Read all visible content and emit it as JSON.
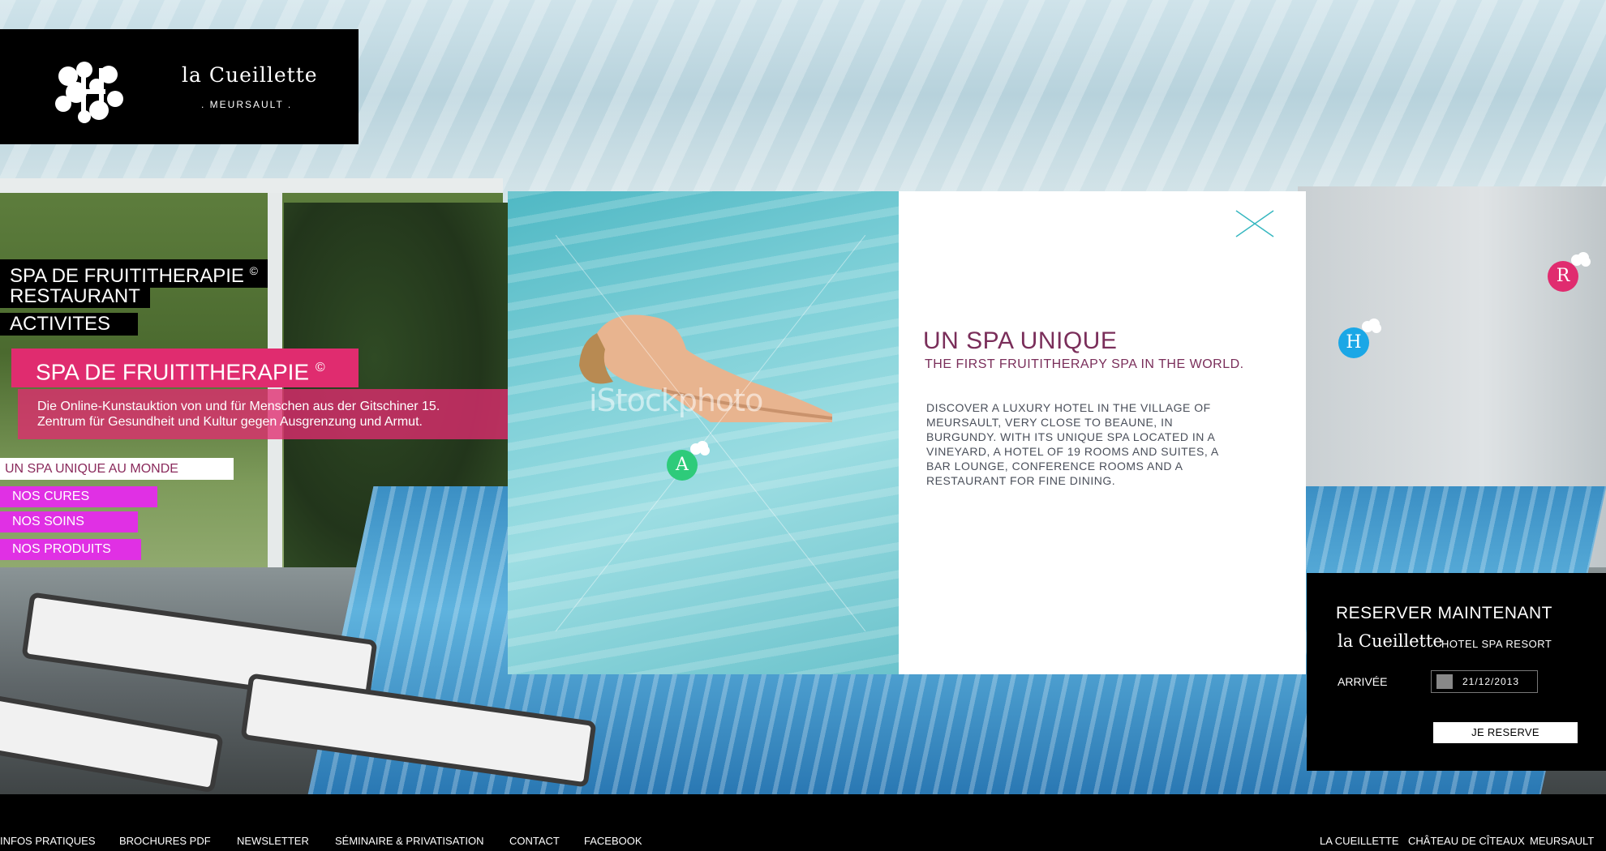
{
  "brand": {
    "name": "la Cueillette",
    "city": ". MEURSAULT ."
  },
  "main_menu": [
    {
      "label": "SPA DE FRUITITHERAPIE",
      "mark": "©"
    },
    {
      "label": "RESTAURANT"
    },
    {
      "label": "ACTIVITES"
    }
  ],
  "feature": {
    "title": "SPA DE FRUITITHERAPIE",
    "mark": "©",
    "description_line1": "Die Online-Kunstauktion von und für Menschen aus der Gitschiner 15.",
    "description_line2": "Zentrum für Gesundheit und Kultur gegen Ausgrenzung und Armut."
  },
  "sub_menu": {
    "active": "UN SPA UNIQUE AU MONDE",
    "items": [
      "NOS CURES",
      "NOS SOINS",
      "NOS PRODUITS"
    ]
  },
  "modal": {
    "title": "UN SPA UNIQUE",
    "subtitle": "THE FIRST FRUITITHERAPY SPA IN THE WORLD.",
    "body_lines": [
      "DISCOVER A LUXURY HOTEL IN THE VILLAGE OF",
      "MEURSAULT, VERY CLOSE TO BEAUNE, IN",
      "BURGUNDY. WITH ITS UNIQUE SPA LOCATED IN A",
      "VINEYARD, A HOTEL OF 19 ROOMS AND SUITES, A",
      "BAR LOUNGE, CONFERENCE ROOMS AND A",
      "RESTAURANT FOR FINE DINING."
    ],
    "photo_watermark": "iStockphoto",
    "close_icon": "close-x-icon"
  },
  "bubbles": [
    {
      "letter": "A",
      "color": "#2ecb7a"
    },
    {
      "letter": "H",
      "color": "#1ba7e6"
    },
    {
      "letter": "R",
      "color": "#e02c6f"
    }
  ],
  "booking": {
    "title": "RESERVER MAINTENANT",
    "brand": "la Cueillette",
    "brand_sub": "HOTEL SPA RESORT",
    "arrival_label": "ARRIVÉE",
    "arrival_date": "21/12/2013",
    "button": "JE RESERVE"
  },
  "footer": {
    "left_links": [
      "INFOS PRATIQUES",
      "BROCHURES PDF",
      "NEWSLETTER",
      "SÉMINAIRE & PRIVATISATION",
      "CONTACT",
      "FACEBOOK"
    ],
    "right_links": [
      "LA CUEILLETTE",
      "CHÂTEAU DE CÎTEAUX",
      "MEURSAULT"
    ]
  },
  "colors": {
    "accent_pink": "#e02c6f",
    "submenu_magenta": "#e030e4",
    "modal_title": "#7a2e5a",
    "background_black": "#000000"
  }
}
